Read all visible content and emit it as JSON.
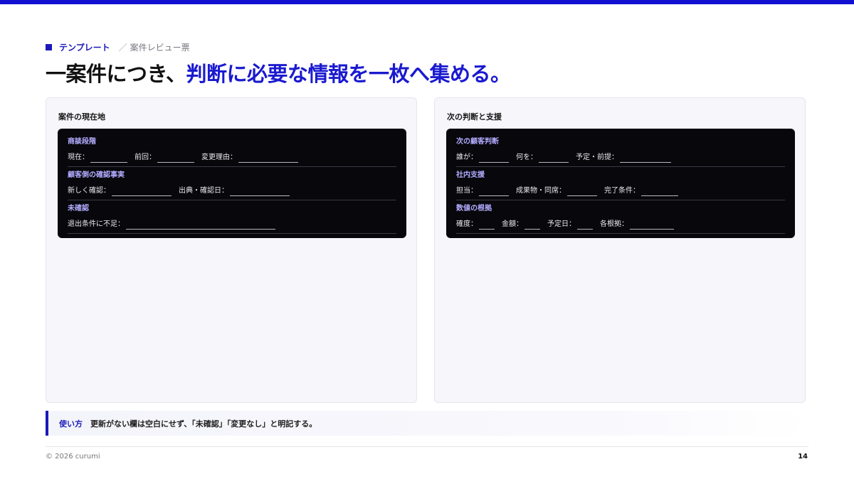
{
  "accent_color": "#1a1ab8",
  "breadcrumb": {
    "category": "テンプレート",
    "separator": "／",
    "page": "案件レビュー票"
  },
  "headline": {
    "prefix": "一案件につき、",
    "accent": "判断に必要な情報を一枚へ集める。"
  },
  "panels": {
    "left": {
      "title": "案件の現在地",
      "sections": [
        {
          "title": "商談段階",
          "fields": [
            "現在：",
            "前回：",
            "変更理由："
          ]
        },
        {
          "title": "顧客側の確認事実",
          "fields": [
            "新しく確認：",
            "出典・確認日："
          ]
        },
        {
          "title": "未確認",
          "fields": [
            "退出条件に不足："
          ]
        }
      ]
    },
    "right": {
      "title": "次の判断と支援",
      "sections": [
        {
          "title": "次の顧客判断",
          "fields": [
            "誰が：",
            "何を：",
            "予定・前提："
          ]
        },
        {
          "title": "社内支援",
          "fields": [
            "担当：",
            "成果物・同席：",
            "完了条件："
          ]
        },
        {
          "title": "数値の根拠",
          "fields": [
            "確度：",
            "金額：",
            "予定日：",
            "各根拠："
          ]
        }
      ]
    }
  },
  "note": {
    "label": "使い方",
    "text": "更新がない欄は空白にせず、「未確認」「変更なし」と明記する。"
  },
  "footer": {
    "copyright": "© 2026 curumi",
    "page_number": "14"
  }
}
